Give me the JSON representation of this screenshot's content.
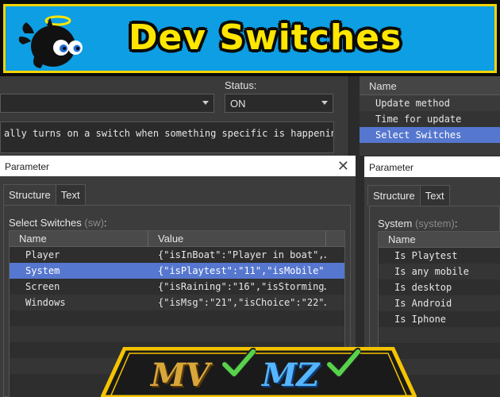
{
  "banner": {
    "title": "Dev Switches"
  },
  "background_editor": {
    "status_label": "Status:",
    "left_dropdown_value": "",
    "status_value": "ON",
    "description": "ally turns on a switch when something specific is happening."
  },
  "background_right": {
    "header": "Name",
    "rows": [
      "Update method",
      "Time for update",
      "Select Switches"
    ]
  },
  "param_left": {
    "title": "Parameter",
    "tabs": [
      "Structure",
      "Text"
    ],
    "group_label": "Select Switches",
    "group_hint": "(sw)",
    "group_colon": ":",
    "columns": [
      "Name",
      "Value"
    ],
    "rows": [
      {
        "name": "Player",
        "value": "{\"isInBoat\":\"Player in boat\",…"
      },
      {
        "name": "System",
        "value": "{\"isPlaytest\":\"11\",\"isMobile\""
      },
      {
        "name": "Screen",
        "value": "{\"isRaining\":\"16\",\"isStorming…"
      },
      {
        "name": "Windows",
        "value": "{\"isMsg\":\"21\",\"isChoice\":\"22\"…"
      }
    ]
  },
  "param_right": {
    "title": "Parameter",
    "tabs": [
      "Structure",
      "Text"
    ],
    "group_label": "System",
    "group_hint": "(system)",
    "group_colon": ":",
    "columns": [
      "Name"
    ],
    "rows": [
      "Is Playtest",
      "Is any mobile",
      "Is desktop",
      "Is Android",
      "Is Iphone"
    ]
  },
  "badge": {
    "mv": "MV",
    "mz": "MZ"
  },
  "colors": {
    "selection": "#5677cf",
    "banner_bg": "#0d9ee3",
    "banner_text": "#ffe600",
    "badge_border": "#f5c400"
  }
}
